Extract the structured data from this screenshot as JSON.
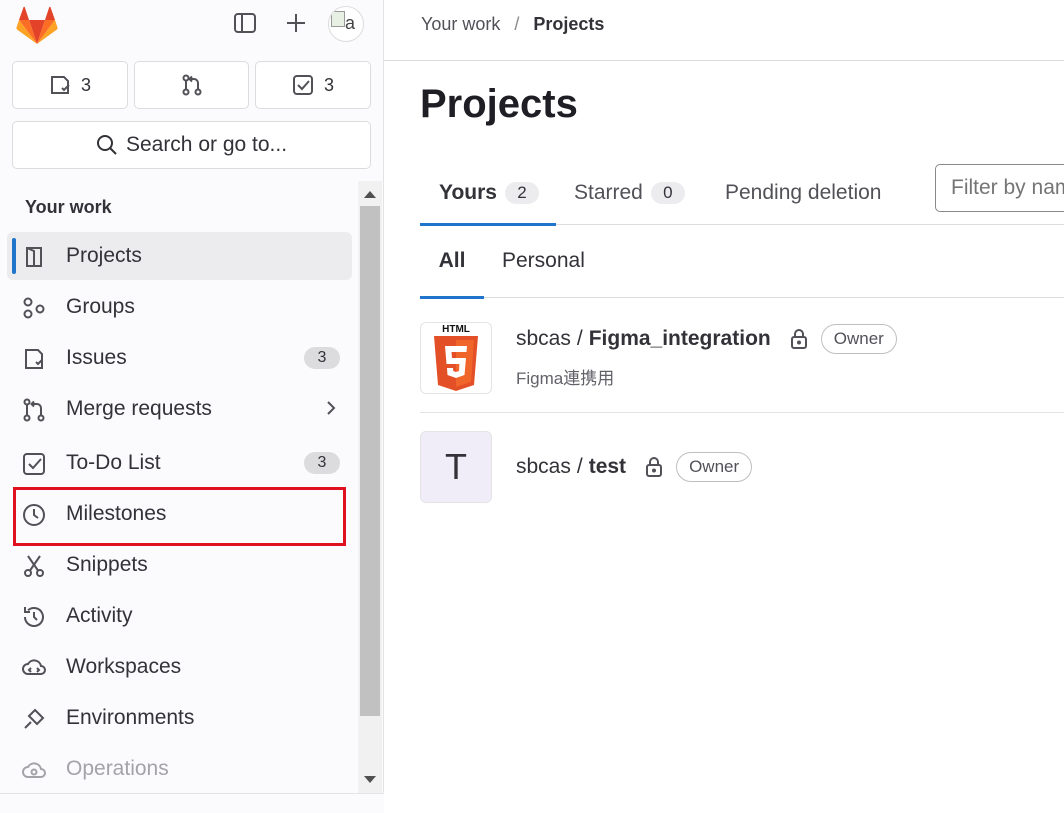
{
  "top": {
    "issues_count": "3",
    "todos_count": "3",
    "search_label": "Search or go to...",
    "avatar_alt": "a"
  },
  "sidebar": {
    "section_title": "Your work",
    "items": [
      {
        "label": "Projects",
        "icon": "project-icon",
        "active": true
      },
      {
        "label": "Groups",
        "icon": "group-icon"
      },
      {
        "label": "Issues",
        "icon": "issues-icon",
        "badge": "3"
      },
      {
        "label": "Merge requests",
        "icon": "merge-request-icon"
      },
      {
        "label": "To-Do List",
        "icon": "todo-icon",
        "badge": "3"
      },
      {
        "label": "Milestones",
        "icon": "clock-icon"
      },
      {
        "label": "Snippets",
        "icon": "snippet-icon"
      },
      {
        "label": "Activity",
        "icon": "history-icon"
      },
      {
        "label": "Workspaces",
        "icon": "workspace-icon"
      },
      {
        "label": "Environments",
        "icon": "environment-icon"
      },
      {
        "label": "Operations",
        "icon": "cloud-gear-icon"
      }
    ],
    "highlight_color": "#e0111e"
  },
  "breadcrumb": {
    "parent": "Your work",
    "separator": "/",
    "current": "Projects"
  },
  "page": {
    "title": "Projects"
  },
  "tabs": [
    {
      "label": "Yours",
      "count": "2",
      "active": true
    },
    {
      "label": "Starred",
      "count": "0"
    },
    {
      "label": "Pending deletion"
    }
  ],
  "filter": {
    "placeholder": "Filter by name"
  },
  "subtabs": [
    {
      "label": "All",
      "active": true
    },
    {
      "label": "Personal"
    }
  ],
  "projects": [
    {
      "namespace": "sbcas",
      "separator": "/",
      "name": "Figma_integration",
      "role": "Owner",
      "description": "Figma連携用",
      "avatar": "html5-logo"
    },
    {
      "namespace": "sbcas",
      "separator": "/",
      "name": "test",
      "role": "Owner",
      "avatar_letter": "T"
    }
  ],
  "colors": {
    "accent": "#1f75cb",
    "sidebar_bg": "#fbfafd"
  }
}
